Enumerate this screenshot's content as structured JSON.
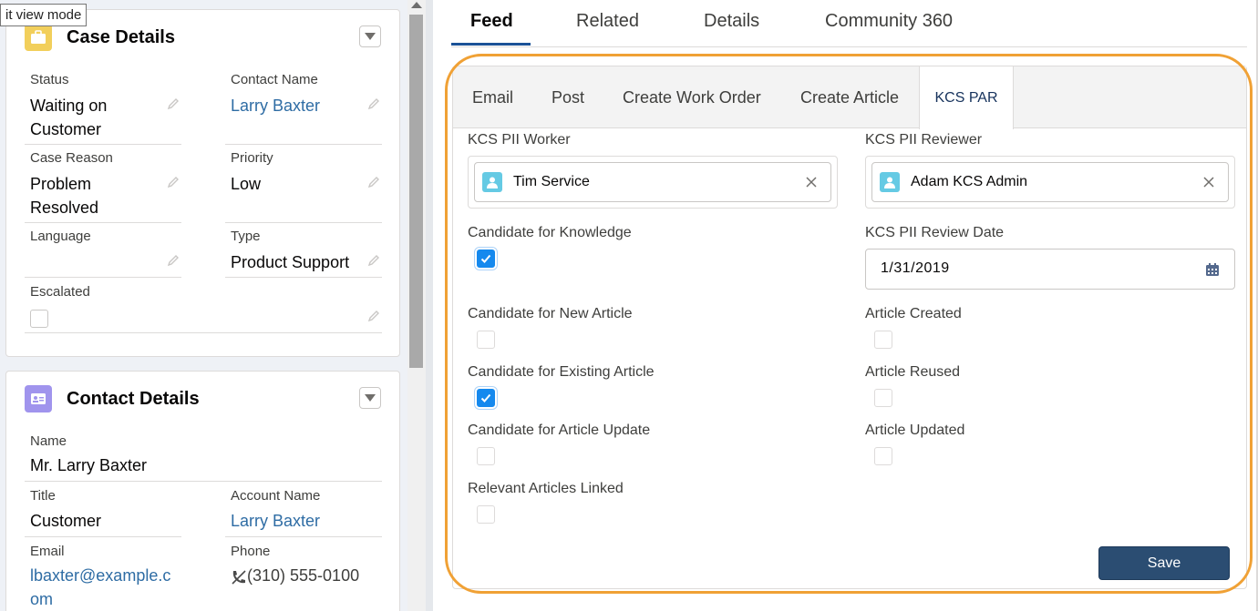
{
  "tooltip": "it view mode",
  "case_card": {
    "title": "Case Details",
    "fields": {
      "status": {
        "label": "Status",
        "value_line1": "Waiting on",
        "value_line2": "Customer"
      },
      "contact_name": {
        "label": "Contact Name",
        "value": "Larry Baxter"
      },
      "case_reason": {
        "label": "Case Reason",
        "value_line1": "Problem",
        "value_line2": "Resolved"
      },
      "priority": {
        "label": "Priority",
        "value": "Low"
      },
      "language": {
        "label": "Language",
        "value": ""
      },
      "type": {
        "label": "Type",
        "value": "Product Support"
      },
      "escalated": {
        "label": "Escalated",
        "checked": false
      }
    }
  },
  "contact_card": {
    "title": "Contact Details",
    "fields": {
      "name": {
        "label": "Name",
        "value": "Mr. Larry Baxter"
      },
      "title": {
        "label": "Title",
        "value": "Customer"
      },
      "account_name": {
        "label": "Account Name",
        "value": "Larry Baxter"
      },
      "email": {
        "label": "Email",
        "value_line1": "lbaxter@example.c",
        "value_line2": "om"
      },
      "phone": {
        "label": "Phone",
        "value": "(310) 555-0100"
      }
    }
  },
  "main_tabs": [
    "Feed",
    "Related",
    "Details",
    "Community 360"
  ],
  "active_main_tab": "Feed",
  "publisher_tabs": [
    "Email",
    "Post",
    "Create Work Order",
    "Create Article",
    "KCS PAR"
  ],
  "active_publisher_tab": "KCS PAR",
  "form": {
    "pii_worker": {
      "label": "KCS PII Worker",
      "value": "Tim Service"
    },
    "pii_reviewer": {
      "label": "KCS PII Reviewer",
      "value": "Adam KCS Admin"
    },
    "candidate_knowledge": {
      "label": "Candidate for Knowledge",
      "checked": true
    },
    "pii_review_date": {
      "label": "KCS PII Review Date",
      "value": "1/31/2019"
    },
    "candidate_new_article": {
      "label": "Candidate for New Article",
      "checked": false
    },
    "article_created": {
      "label": "Article Created",
      "checked": false
    },
    "candidate_existing_article": {
      "label": "Candidate for Existing Article",
      "checked": true
    },
    "article_reused": {
      "label": "Article Reused",
      "checked": false
    },
    "candidate_article_update": {
      "label": "Candidate for Article Update",
      "checked": false
    },
    "article_updated": {
      "label": "Article Updated",
      "checked": false
    },
    "relevant_articles_linked": {
      "label": "Relevant Articles Linked",
      "checked": false
    },
    "save_label": "Save"
  },
  "colors": {
    "accent_blue": "#1589ee",
    "save_button": "#2b4d72",
    "highlight_outline": "#f0a135",
    "link": "#2e6ca4"
  }
}
